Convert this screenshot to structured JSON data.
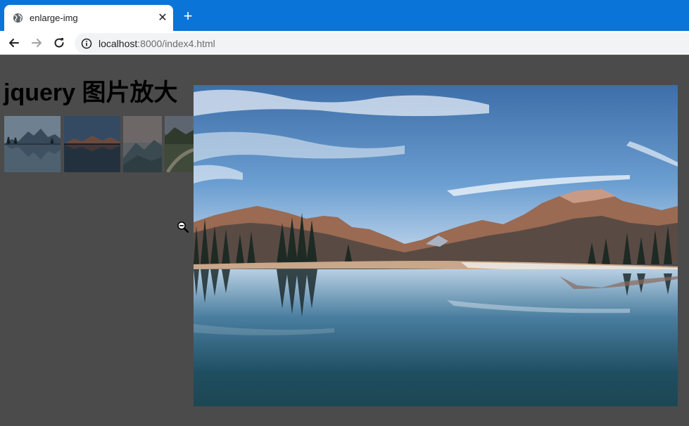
{
  "browser": {
    "tab_title": "enlarge-img",
    "url_host": "localhost",
    "url_rest": ":8000/index4.html",
    "icons": {
      "tab": "globe-icon",
      "close": "close-icon",
      "new_tab": "plus-icon",
      "back": "back-arrow-icon",
      "forward": "forward-arrow-icon",
      "reload": "reload-icon",
      "site_info": "info-icon"
    }
  },
  "page": {
    "heading": "jquery 图片放大",
    "background_color": "#4b4b4b",
    "thumbnails": [
      {
        "name": "thumbnail-mountain-lake-1"
      },
      {
        "name": "thumbnail-mountain-lake-2"
      },
      {
        "name": "thumbnail-foggy-mountain"
      },
      {
        "name": "thumbnail-mountain-road"
      }
    ],
    "cursor_icon": "zoom-out-cursor-icon",
    "enlarged_image": "mountain-lake-reflection"
  },
  "colors": {
    "tabbar": "#0a74d8",
    "accent": "#0a74d8"
  }
}
